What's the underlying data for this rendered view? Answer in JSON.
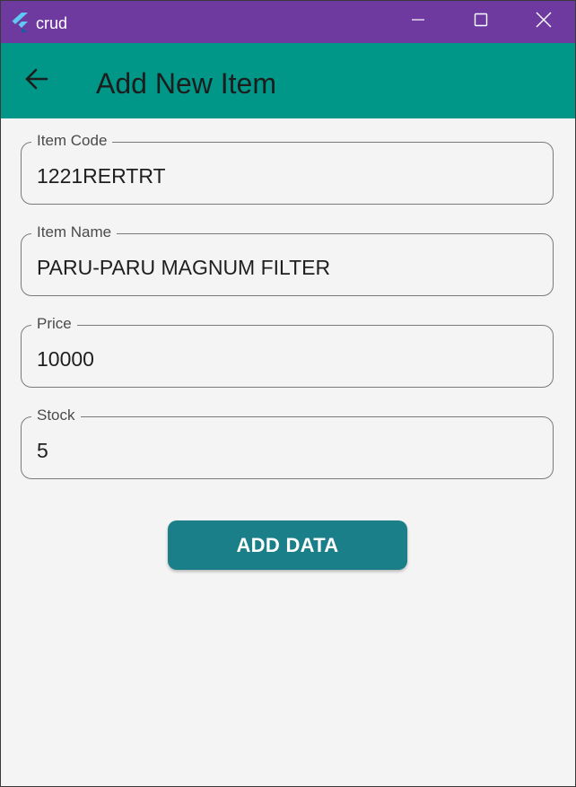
{
  "window": {
    "title": "crud",
    "titlebar_color": "#6e3aa0",
    "icons": {
      "app": "flutter-logo-icon",
      "minimize": "minimize-icon",
      "maximize": "maximize-icon",
      "close": "close-icon"
    }
  },
  "appbar": {
    "title": "Add New Item",
    "color": "#009688",
    "back_icon": "arrow-back-icon"
  },
  "form": {
    "fields": [
      {
        "label": "Item Code",
        "value": "1221RERTRT"
      },
      {
        "label": "Item Name",
        "value": "PARU-PARU MAGNUM FILTER"
      },
      {
        "label": "Price",
        "value": "10000"
      },
      {
        "label": "Stock",
        "value": "5"
      }
    ],
    "submit_label": "ADD DATA",
    "submit_color": "#1a7f88"
  }
}
